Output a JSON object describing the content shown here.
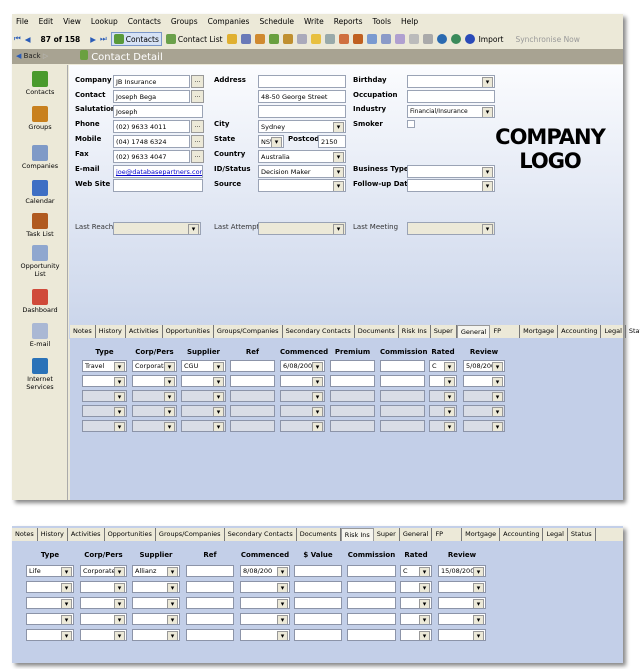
{
  "menu": [
    "File",
    "Edit",
    "View",
    "Lookup",
    "Contacts",
    "Groups",
    "Companies",
    "Schedule",
    "Write",
    "Reports",
    "Tools",
    "Help"
  ],
  "toolbar": {
    "record_position": "87 of 158",
    "contacts": "Contacts",
    "contact_list": "Contact List",
    "import": "Import",
    "synchronise": "Synchronise Now"
  },
  "header": {
    "back": "Back",
    "title": "Contact Detail"
  },
  "sidebar": [
    {
      "label": "Contacts",
      "color": "#4a9a2c"
    },
    {
      "label": "Groups",
      "color": "#c8801e"
    },
    {
      "label": "Companies",
      "color": "#7f9ac7"
    },
    {
      "label": "Calendar",
      "color": "#3e6fc4"
    },
    {
      "label": "Task List",
      "color": "#b05a20"
    },
    {
      "label": "Opportunity List",
      "color": "#8fa7cf"
    },
    {
      "label": "Dashboard",
      "color": "#d04a3a"
    },
    {
      "label": "E-mail",
      "color": "#aab8d4"
    },
    {
      "label": "Internet Services",
      "color": "#2a72b8"
    }
  ],
  "form": {
    "company": {
      "label": "Company",
      "value": "JB Insurance"
    },
    "contact": {
      "label": "Contact",
      "value": "Joseph Bega"
    },
    "salutation": {
      "label": "Salutation",
      "value": "Joseph"
    },
    "phone": {
      "label": "Phone",
      "value": "(02) 9633 4011"
    },
    "mobile": {
      "label": "Mobile",
      "value": "(04) 1748 6324"
    },
    "fax": {
      "label": "Fax",
      "value": "(02) 9633 4047"
    },
    "email": {
      "label": "E-mail",
      "value": "joe@databasepartners.com.au"
    },
    "website": {
      "label": "Web Site",
      "value": ""
    },
    "address": {
      "label": "Address",
      "line1": "",
      "line2": "48-50 George Street",
      "line3": ""
    },
    "city": {
      "label": "City",
      "value": "Sydney"
    },
    "state": {
      "label": "State",
      "value": "NSW"
    },
    "postcode": {
      "label": "Postcode",
      "value": "2150"
    },
    "country": {
      "label": "Country",
      "value": "Australia"
    },
    "id_status": {
      "label": "ID/Status",
      "value": "Decision Maker"
    },
    "source": {
      "label": "Source",
      "value": ""
    },
    "birthday": {
      "label": "Birthday",
      "value": ""
    },
    "occupation": {
      "label": "Occupation",
      "value": ""
    },
    "industry": {
      "label": "Industry",
      "value": "Financial/Insurance"
    },
    "smoker": {
      "label": "Smoker",
      "checked": false
    },
    "business_type": {
      "label": "Business Type",
      "value": ""
    },
    "followup_date": {
      "label": "Follow-up Date",
      "value": ""
    },
    "last_reach": {
      "label": "Last Reach",
      "value": ""
    },
    "last_attempt": {
      "label": "Last Attempt",
      "value": ""
    },
    "last_meeting": {
      "label": "Last Meeting",
      "value": ""
    }
  },
  "logo": {
    "line1": "COMPANY",
    "line2": "LOGO"
  },
  "tabs": [
    "Notes",
    "History",
    "Activities",
    "Opportunities",
    "Groups/Companies",
    "Secondary Contacts",
    "Documents",
    "Risk Ins",
    "Super",
    "General",
    "FP",
    "Mortgage",
    "Accounting",
    "Legal",
    "Status"
  ],
  "panel_top": {
    "active_tab": "General",
    "headers": [
      "Type",
      "Corp/Pers",
      "Supplier",
      "Ref",
      "Commenced",
      "Premium",
      "Commission",
      "Rated",
      "Review"
    ],
    "rows": [
      [
        "Travel",
        "Corporate",
        "CGU",
        "",
        "6/08/200",
        "",
        "",
        "C",
        "5/08/200"
      ],
      [
        "",
        "",
        "",
        "",
        "",
        "",
        "",
        "",
        ""
      ],
      [
        "",
        "",
        "",
        "",
        "",
        "",
        "",
        "",
        ""
      ],
      [
        "",
        "",
        "",
        "",
        "",
        "",
        "",
        "",
        ""
      ],
      [
        "",
        "",
        "",
        "",
        "",
        "",
        "",
        "",
        ""
      ]
    ]
  },
  "panel_bottom": {
    "active_tab": "Risk Ins",
    "headers": [
      "Type",
      "Corp/Pers",
      "Supplier",
      "Ref",
      "Commenced",
      "$ Value",
      "Commission",
      "Rated",
      "Review"
    ],
    "rows": [
      [
        "Life",
        "Corporate",
        "Allianz",
        "",
        "8/08/200",
        "",
        "",
        "C",
        "15/08/200"
      ],
      [
        "",
        "",
        "",
        "",
        "",
        "",
        "",
        "",
        ""
      ],
      [
        "",
        "",
        "",
        "",
        "",
        "",
        "",
        "",
        ""
      ],
      [
        "",
        "",
        "",
        "",
        "",
        "",
        "",
        "",
        ""
      ],
      [
        "",
        "",
        "",
        "",
        "",
        "",
        "",
        "",
        ""
      ]
    ]
  }
}
